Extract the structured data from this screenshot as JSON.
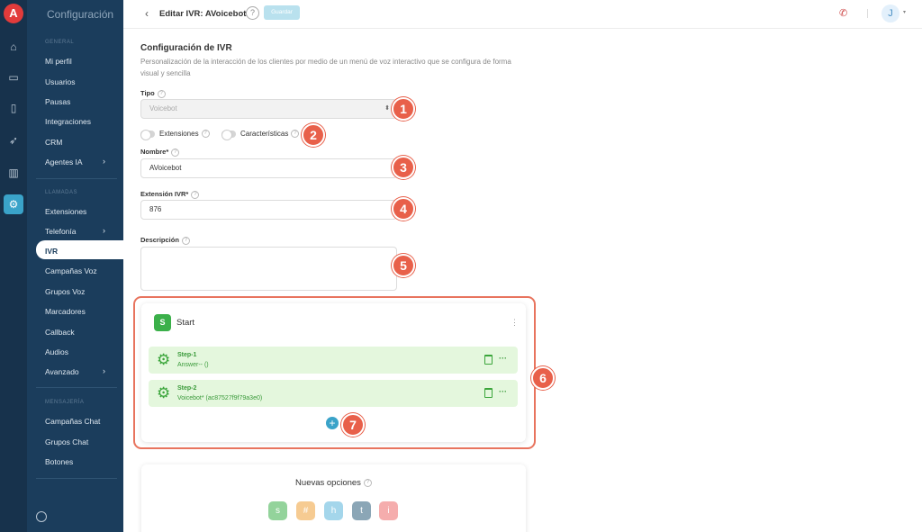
{
  "app": {
    "logo_letter": "A",
    "section_title": "Configuración"
  },
  "rail": {
    "icons": [
      "home-icon",
      "monitor-icon",
      "phone-icon",
      "rocket-icon",
      "chart-icon",
      "settings-icon"
    ]
  },
  "sidebar": {
    "general_header": "GENERAL",
    "general_items": [
      {
        "label": "Mi perfil"
      },
      {
        "label": "Usuarios"
      },
      {
        "label": "Pausas"
      },
      {
        "label": "Integraciones"
      },
      {
        "label": "CRM"
      },
      {
        "label": "Agentes IA",
        "has_arrow": true
      }
    ],
    "calls_header": "LLAMADAS",
    "calls_items": [
      {
        "label": "Extensiones"
      },
      {
        "label": "Telefonía",
        "has_arrow": true
      },
      {
        "label": "IVR",
        "active": true
      },
      {
        "label": "Campañas Voz"
      },
      {
        "label": "Grupos Voz"
      },
      {
        "label": "Marcadores"
      },
      {
        "label": "Callback"
      },
      {
        "label": "Audios"
      },
      {
        "label": "Avanzado",
        "has_arrow": true
      }
    ],
    "messaging_header": "MENSAJERÍA",
    "messaging_items": [
      {
        "label": "Campañas Chat"
      },
      {
        "label": "Grupos Chat"
      },
      {
        "label": "Botones"
      }
    ],
    "arrow_glyph": "›"
  },
  "header": {
    "back_glyph": "‹",
    "title": "Editar IVR: AVoicebot",
    "help_glyph": "?",
    "save_label": "Guardar",
    "avatar_initial": "J",
    "caret_glyph": "▾"
  },
  "form": {
    "heading": "Configuración de IVR",
    "description": "Personalización de la interacción de los clientes por medio de un menú de voz interactivo que se configura de forma visual y sencilla",
    "tipo_label": "Tipo",
    "tipo_value": "Voicebot",
    "extensiones_label": "Extensiones",
    "caracteristicas_label": "Características",
    "nombre_label": "Nombre*",
    "nombre_value": "AVoicebot",
    "extension_label": "Extensión IVR*",
    "extension_value": "876",
    "descripcion_label": "Descripción",
    "descripcion_value": "",
    "help_glyph": "?"
  },
  "flow": {
    "start_icon_letter": "S",
    "start_label": "Start",
    "kebab_glyph": "⋮",
    "steps": [
      {
        "name": "Step-1",
        "detail": "Answer-- ()"
      },
      {
        "name": "Step-2",
        "detail": "Voicebot* (ac87527f9f79a3e0)"
      }
    ],
    "gear_glyph": "⚙",
    "more_glyph": "···",
    "add_glyph": "+"
  },
  "new_options": {
    "title": "Nuevas opciones",
    "options": [
      {
        "letter": "s",
        "color": "#3bb04a"
      },
      {
        "letter": "#",
        "color": "#f0a23a"
      },
      {
        "letter": "h",
        "color": "#5bb6dc"
      },
      {
        "letter": "t",
        "color": "#2e5f7c"
      },
      {
        "letter": "i",
        "color": "#ee6b6b"
      }
    ]
  },
  "annotations": [
    "1",
    "2",
    "3",
    "4",
    "5",
    "6",
    "7"
  ],
  "colors": {
    "rail": "#17324c",
    "sidebar": "#1b3d5c",
    "accent": "#3aa3c9",
    "badge": "#e8604a",
    "step_bg": "#e4f7dd",
    "step_text": "#3a9a3a"
  }
}
